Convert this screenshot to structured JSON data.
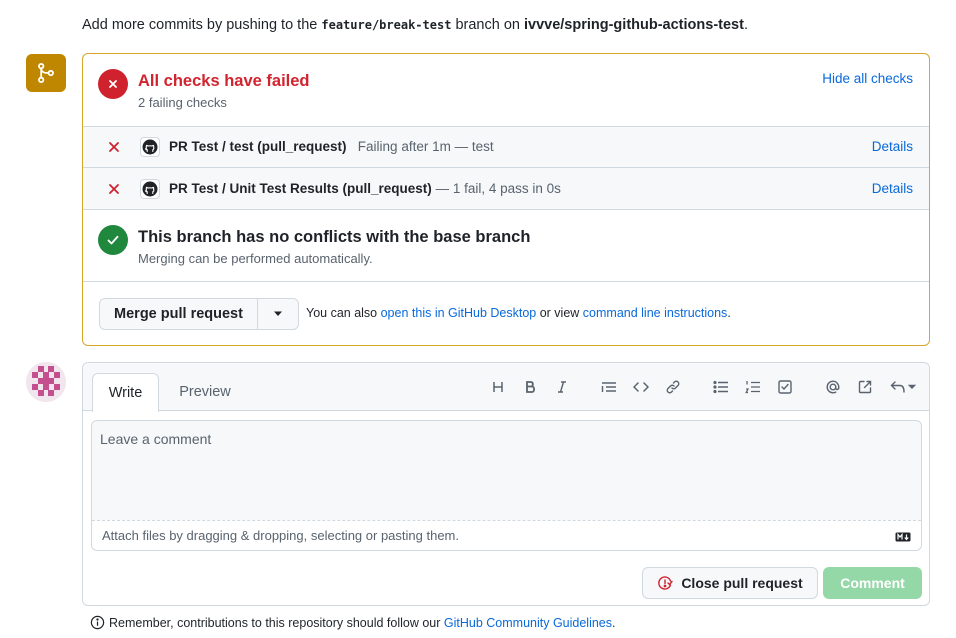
{
  "top_note": {
    "prefix": "Add more commits by pushing to the ",
    "branch": "feature/break-test",
    "middle": " branch on ",
    "repo": "ivvve/spring-github-actions-test",
    "suffix": "."
  },
  "checks": {
    "title": "All checks have failed",
    "subtitle": "2 failing checks",
    "hide_label": "Hide all checks",
    "items": [
      {
        "name": "PR Test / test (pull_request)",
        "status": "Failing after 1m — test",
        "details": "Details"
      },
      {
        "name": "PR Test / Unit Test Results (pull_request)",
        "status": "— 1 fail, 4 pass in 0s",
        "details": "Details"
      }
    ]
  },
  "conflicts": {
    "title": "This branch has no conflicts with the base branch",
    "subtitle": "Merging can be performed automatically."
  },
  "merge": {
    "button_label": "Merge pull request",
    "hint_prefix": "You can also ",
    "desktop_link": "open this in GitHub Desktop",
    "hint_middle": " or view ",
    "cli_link": "command line instructions",
    "hint_suffix": "."
  },
  "comment": {
    "tab_write": "Write",
    "tab_preview": "Preview",
    "placeholder": "Leave a comment",
    "attach_text": "Attach files by dragging & dropping, selecting or pasting them.",
    "close_button": "Close pull request",
    "comment_button": "Comment"
  },
  "toolbar_icons": [
    "heading-icon",
    "bold-icon",
    "italic-icon",
    "quote-icon",
    "code-icon",
    "link-icon",
    "unordered-list-icon",
    "ordered-list-icon",
    "tasklist-icon",
    "mention-icon",
    "reference-icon",
    "reply-icon"
  ],
  "footer": {
    "prefix": "Remember, contributions to this repository should follow our ",
    "link": "GitHub Community Guidelines",
    "suffix": "."
  },
  "colors": {
    "fail": "#cf222e",
    "success": "#1f883d",
    "warning_border": "#d4a72c",
    "merge_icon_bg": "#bf8700",
    "link": "#0969da",
    "comment_btn": "#95d8a7"
  }
}
